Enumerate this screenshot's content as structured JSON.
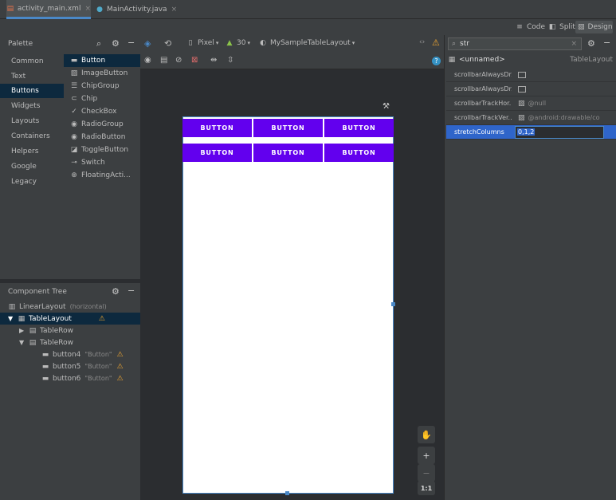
{
  "tabs": [
    {
      "label": "activity_main.xml",
      "icon": "xml-layout-icon",
      "active": true
    },
    {
      "label": "MainActivity.java",
      "icon": "java-class-icon",
      "active": false
    }
  ],
  "modes": {
    "code": "Code",
    "split": "Split",
    "design": "Design"
  },
  "palette": {
    "title": "Palette",
    "categories": [
      "Common",
      "Text",
      "Buttons",
      "Widgets",
      "Layouts",
      "Containers",
      "Helpers",
      "Google",
      "Legacy"
    ],
    "selected_category": "Buttons",
    "items": [
      "Button",
      "ImageButton",
      "ChipGroup",
      "Chip",
      "CheckBox",
      "RadioGroup",
      "RadioButton",
      "ToggleButton",
      "Switch",
      "FloatingActi..."
    ],
    "selected_item": "Button"
  },
  "toolbar": {
    "device": "Pixel",
    "api": "30",
    "theme": "MySampleTableLayout"
  },
  "component_tree": {
    "title": "Component Tree",
    "nodes": [
      {
        "label": "LinearLayout",
        "hint": "(horizontal)",
        "warning": false
      },
      {
        "label": "TableLayout",
        "hint": "",
        "warning": true
      },
      {
        "label": "TableRow",
        "hint": "",
        "warning": false
      },
      {
        "label": "TableRow",
        "hint": "",
        "warning": false
      },
      {
        "label": "button4",
        "hint": "\"Button\"",
        "warning": true
      },
      {
        "label": "button5",
        "hint": "\"Button\"",
        "warning": true
      },
      {
        "label": "button6",
        "hint": "\"Button\"",
        "warning": true
      }
    ]
  },
  "preview": {
    "rows": [
      [
        "BUTTON",
        "BUTTON",
        "BUTTON"
      ],
      [
        "BUTTON",
        "BUTTON",
        "BUTTON"
      ]
    ],
    "button_color": "#6200ee"
  },
  "attributes": {
    "search_value": "str",
    "component_name": "<unnamed>",
    "component_type": "TableLayout",
    "rows": [
      {
        "name": "scrollbarAlwaysDr...",
        "value": ""
      },
      {
        "name": "scrollbarAlwaysDr...",
        "value": ""
      },
      {
        "name": "scrollbarTrackHor...",
        "value": "@null"
      },
      {
        "name": "scrollbarTrackVer...",
        "value": "@android:drawable/co"
      },
      {
        "name": "stretchColumns",
        "value": "0,1,2"
      }
    ]
  },
  "zoom": {
    "plus": "+",
    "minus": "−",
    "one_to_one": "1:1"
  }
}
